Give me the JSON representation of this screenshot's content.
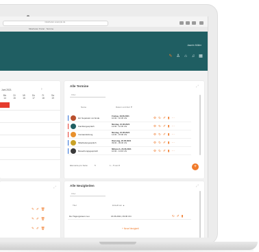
{
  "browser": {
    "url": "mitarbeiter.example.de",
    "tab_title": "Mitarbeiter Portal · Termine"
  },
  "app": {
    "user_label": "Jasmin Müller",
    "icons": [
      "edit-icon",
      "person-icon",
      "home-icon",
      "bell-icon",
      "grid-icon"
    ]
  },
  "calendar": {
    "month_label": "Juni 2021",
    "columns": [
      {
        "day": "Mo",
        "date": "14"
      },
      {
        "day": "Di",
        "date": "15"
      },
      {
        "day": "Mi",
        "date": "16"
      },
      {
        "day": "Do",
        "date": "17"
      },
      {
        "day": "Fr",
        "date": "18"
      },
      {
        "day": "Sa",
        "date": "19"
      },
      {
        "day": "So",
        "date": "20"
      }
    ]
  },
  "appointments": {
    "title": "Alle Termine",
    "filter_placeholder": "Filter",
    "col_name": "Name",
    "col_date": "Datum und Zeit ▼",
    "rows": [
      {
        "name": "Ein Separator vor Ende",
        "day": "Freitag, 18.06.2021",
        "time": "10:00 - 10:45 Uhr",
        "bar": "#2f6fd6",
        "avatar": "#b9502e"
      },
      {
        "name": "Familiengespräch",
        "day": "Montag, 21.06.2021",
        "time": "12:00 - 12:45 Uhr",
        "bar": "#e63b2e",
        "avatar": "#1f5e62"
      },
      {
        "name": "Vorstandsitzung",
        "day": "Montag, 21.06.2021",
        "time": "14:00 - 15:00 Uhr",
        "bar": "#e63b2e",
        "avatar": "#e8902c"
      },
      {
        "name": "Mitarbeitergespräch",
        "day": "Dienstag, 22.06.2021",
        "time": "09:00 - 09:30 Uhr",
        "bar": "#2f6fd6",
        "avatar": "#c9a227"
      },
      {
        "name": "Bewerbungsgespräch",
        "day": "Mittwoch, 23.06.2021",
        "time": "10:00 - 11:00 Uhr",
        "bar": "#2f6fd6",
        "avatar": "#3a3a3a"
      }
    ],
    "rows_per_page_label": "Elemente pro Seite:",
    "rows_per_page": "5",
    "page_info": "1 – 5 von 8"
  },
  "news": {
    "title": "Alle Neuigkeiten",
    "filter_placeholder": "Filter",
    "col_name": "Titel",
    "col_date": "Erstellt am ▲",
    "rows": [
      {
        "name": "Der Tagungsraum neu",
        "date": "16.06.2021, 09:00 Uhr"
      }
    ],
    "add_label": "+ Neue Neuigkeit"
  },
  "left_panel": {
    "rows": 3
  }
}
